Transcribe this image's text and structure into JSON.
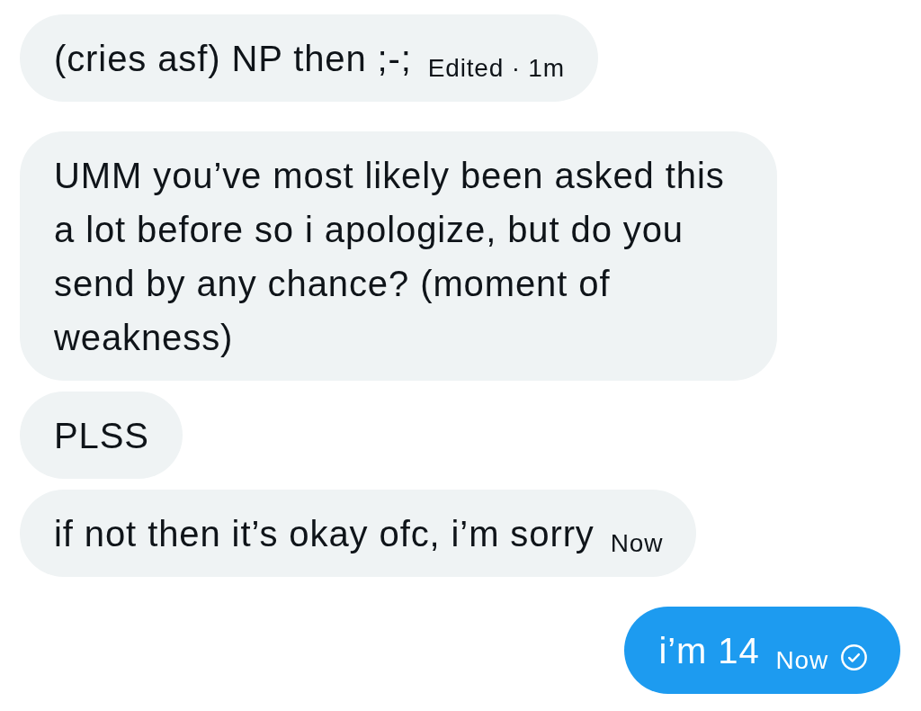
{
  "messages": [
    {
      "kind": "received",
      "text": "(cries asf) NP then ;-;",
      "meta": "Edited · 1m",
      "delivered": false
    },
    {
      "kind": "received",
      "text": "UMM you’ve most likely been asked this a lot before so i apologize, but do you send by any chance? (moment of weakness)",
      "delivered": false
    },
    {
      "kind": "received",
      "text": "PLSS",
      "delivered": false
    },
    {
      "kind": "received",
      "text": "if not then it’s okay ofc, i’m sorry",
      "meta": "Now",
      "delivered": false
    },
    {
      "kind": "sent",
      "text": "i’m 14",
      "meta": "Now",
      "delivered": true
    }
  ]
}
